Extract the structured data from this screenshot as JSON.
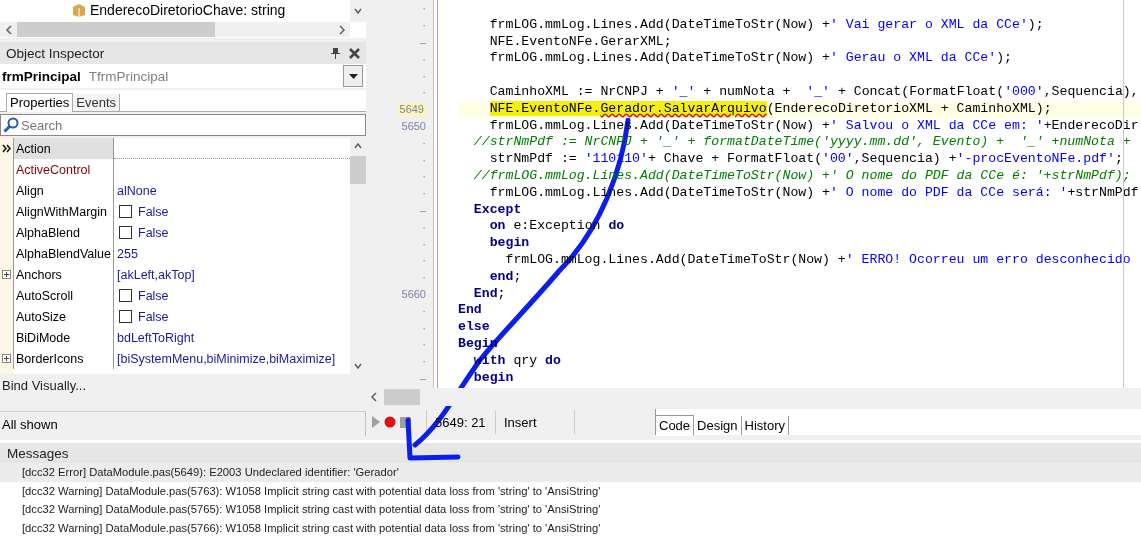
{
  "structure_tree": {
    "items": [
      {
        "label": "EnderecoDiretorioChave: string"
      }
    ]
  },
  "object_inspector": {
    "title": "Object Inspector",
    "object_name": "frmPrincipal",
    "object_type": "TfrmPrincipal",
    "tabs": [
      {
        "label": "Properties",
        "selected": true
      },
      {
        "label": "Events",
        "selected": false
      }
    ],
    "search": {
      "placeholder": "Search"
    },
    "properties": [
      {
        "name": "Action",
        "kind": "text",
        "selected": true,
        "linked": false,
        "expandable": false
      },
      {
        "name": "ActiveControl",
        "kind": "text",
        "selected": false,
        "linked": true,
        "expandable": false
      },
      {
        "name": "Align",
        "kind": "text",
        "value": "alNone",
        "selected": false,
        "linked": false,
        "expandable": false
      },
      {
        "name": "AlignWithMargin",
        "kind": "bool",
        "value": "False",
        "checked": false,
        "selected": false,
        "linked": false,
        "expandable": false
      },
      {
        "name": "AlphaBlend",
        "kind": "bool",
        "value": "False",
        "checked": false,
        "selected": false,
        "linked": false,
        "expandable": false
      },
      {
        "name": "AlphaBlendValue",
        "kind": "text",
        "value": "255",
        "selected": false,
        "linked": false,
        "expandable": false
      },
      {
        "name": "Anchors",
        "kind": "text",
        "value": "[akLeft,akTop]",
        "selected": false,
        "linked": false,
        "expandable": true
      },
      {
        "name": "AutoScroll",
        "kind": "bool",
        "value": "False",
        "checked": false,
        "selected": false,
        "linked": false,
        "expandable": false
      },
      {
        "name": "AutoSize",
        "kind": "bool",
        "value": "False",
        "checked": false,
        "selected": false,
        "linked": false,
        "expandable": false
      },
      {
        "name": "BiDiMode",
        "kind": "text",
        "value": "bdLeftToRight",
        "selected": false,
        "linked": false,
        "expandable": false
      },
      {
        "name": "BorderIcons",
        "kind": "text",
        "value": "[biSystemMenu,biMinimize,biMaximize]",
        "selected": false,
        "linked": false,
        "expandable": true
      }
    ],
    "bind_link": "Bind Visually...",
    "status": "All shown"
  },
  "editor": {
    "lines": [
      {
        "gutter": "·",
        "current": false
      },
      {
        "gutter": "·",
        "current": false,
        "segments": [
          {
            "kind": "plain",
            "text": "    frmLOG.mmLog.Lines.Add(DateTimeToStr(Now) +"
          },
          {
            "kind": "string",
            "text": "' Vai gerar o XML da CCe'"
          },
          {
            "kind": "plain",
            "text": ");"
          }
        ]
      },
      {
        "gutter": "–",
        "current": false,
        "segments": [
          {
            "kind": "plain",
            "text": "    NFE.EventoNFe.GerarXML;"
          }
        ]
      },
      {
        "gutter": "·",
        "current": false,
        "segments": [
          {
            "kind": "plain",
            "text": "    frmLOG.mmLog.Lines.Add(DateTimeToStr(Now) +"
          },
          {
            "kind": "string",
            "text": "' Gerau o XML da CCe'"
          },
          {
            "kind": "plain",
            "text": ");"
          }
        ]
      },
      {
        "gutter": "·",
        "current": false
      },
      {
        "gutter": "·",
        "current": false,
        "segments": [
          {
            "kind": "plain",
            "text": "    CaminhoXML := NrCNPJ + "
          },
          {
            "kind": "string",
            "text": "'_'"
          },
          {
            "kind": "plain",
            "text": " + numNota +  "
          },
          {
            "kind": "string",
            "text": "'_'"
          },
          {
            "kind": "plain",
            "text": " + Concat(FormatFloat("
          },
          {
            "kind": "string",
            "text": "'000'"
          },
          {
            "kind": "plain",
            "text": ",Sequencia),"
          }
        ]
      },
      {
        "gutter": "5649",
        "current": true,
        "segments": [
          {
            "kind": "marked",
            "text": "    NFE.EventoNFe."
          },
          {
            "kind": "marked-error",
            "text": "Gerador.SalvarArquivo"
          },
          {
            "kind": "plain",
            "text": "(EnderecoDiretorioXML + CaminhoXML);"
          }
        ]
      },
      {
        "gutter": "5650",
        "current": false,
        "segments": [
          {
            "kind": "plain",
            "text": "    frmLOG.mmLog.Lines.Add(DateTimeToStr(Now) +"
          },
          {
            "kind": "string",
            "text": "' Salvou o XML da CCe em: '"
          },
          {
            "kind": "plain",
            "text": "+EnderecoDir"
          }
        ]
      },
      {
        "gutter": "·",
        "current": false,
        "segments": [
          {
            "kind": "comment",
            "text": "  //strNmPdf := NrCNPJ + '_' + formatDateTime('yyyy.mm.dd', Evento) +  '_' +numNota +"
          }
        ]
      },
      {
        "gutter": "·",
        "current": false,
        "segments": [
          {
            "kind": "plain",
            "text": "    strNmPdf := "
          },
          {
            "kind": "string",
            "text": "'110110'"
          },
          {
            "kind": "plain",
            "text": "+ Chave + FormatFloat("
          },
          {
            "kind": "string",
            "text": "'00'"
          },
          {
            "kind": "plain",
            "text": ",Sequencia) +"
          },
          {
            "kind": "string",
            "text": "'-procEventoNFe.pdf'"
          },
          {
            "kind": "plain",
            "text": ";"
          }
        ]
      },
      {
        "gutter": "·",
        "current": false,
        "segments": [
          {
            "kind": "comment",
            "text": "  //frmLOG.mmLog.Lines.Add(DateTimeToStr(Now) +' O nome do PDF da CCe é: '+strNmPdf);"
          }
        ]
      },
      {
        "gutter": "·",
        "current": false,
        "segments": [
          {
            "kind": "plain",
            "text": "    frmLOG.mmLog.Lines.Add(DateTimeToStr(Now) +"
          },
          {
            "kind": "string",
            "text": "' O nome do PDF da CCe será: '"
          },
          {
            "kind": "plain",
            "text": "+strNmPdf"
          }
        ]
      },
      {
        "gutter": "–",
        "current": false,
        "segments": [
          {
            "kind": "keyword",
            "text": "  Except"
          }
        ]
      },
      {
        "gutter": "·",
        "current": false,
        "segments": [
          {
            "kind": "keyword",
            "text": "    on"
          },
          {
            "kind": "plain",
            "text": " e:Exception "
          },
          {
            "kind": "keyword",
            "text": "do"
          }
        ]
      },
      {
        "gutter": "·",
        "current": false,
        "segments": [
          {
            "kind": "keyword",
            "text": "    begin"
          }
        ]
      },
      {
        "gutter": "·",
        "current": false,
        "segments": [
          {
            "kind": "plain",
            "text": "      frmLOG.mmLog.Lines.Add(DateTimeToStr(Now) +"
          },
          {
            "kind": "string",
            "text": "' ERRO! Ocorreu um erro desconhecido"
          }
        ]
      },
      {
        "gutter": "·",
        "current": false,
        "segments": [
          {
            "kind": "keyword",
            "text": "    end"
          },
          {
            "kind": "plain",
            "text": ";"
          }
        ]
      },
      {
        "gutter": "5660",
        "current": false,
        "segments": [
          {
            "kind": "keyword",
            "text": "  End"
          },
          {
            "kind": "plain",
            "text": ";"
          }
        ]
      },
      {
        "gutter": "·",
        "current": false,
        "segments": [
          {
            "kind": "keyword",
            "text": "End"
          }
        ]
      },
      {
        "gutter": "·",
        "current": false,
        "segments": [
          {
            "kind": "keyword",
            "text": "else"
          }
        ]
      },
      {
        "gutter": "·",
        "current": false,
        "segments": [
          {
            "kind": "keyword",
            "text": "Begin"
          }
        ]
      },
      {
        "gutter": "·",
        "current": false,
        "segments": [
          {
            "kind": "keyword",
            "text": "  with"
          },
          {
            "kind": "plain",
            "text": " qry "
          },
          {
            "kind": "keyword",
            "text": "do"
          }
        ]
      },
      {
        "gutter": "–",
        "current": false,
        "segments": [
          {
            "kind": "keyword",
            "text": "  begin"
          }
        ]
      }
    ]
  },
  "editor_status": {
    "position": "5649: 21",
    "mode": "Insert",
    "tabs": [
      {
        "label": "Code",
        "selected": true
      },
      {
        "label": "Design",
        "selected": false
      },
      {
        "label": "History",
        "selected": false
      }
    ]
  },
  "messages": {
    "title": "Messages",
    "items": [
      {
        "text": "[dcc32 Error] DataModule.pas(5649): E2003 Undeclared identifier: 'Gerador'",
        "selected": true
      },
      {
        "text": "[dcc32 Warning] DataModule.pas(5763): W1058 Implicit string cast with potential data loss from 'string' to 'AnsiString'",
        "selected": false
      },
      {
        "text": "[dcc32 Warning] DataModule.pas(5765): W1058 Implicit string cast with potential data loss from 'string' to 'AnsiString'",
        "selected": false
      },
      {
        "text": "[dcc32 Warning] DataModule.pas(5766): W1058 Implicit string cast with potential data loss from 'string' to 'AnsiString'",
        "selected": false
      }
    ]
  }
}
